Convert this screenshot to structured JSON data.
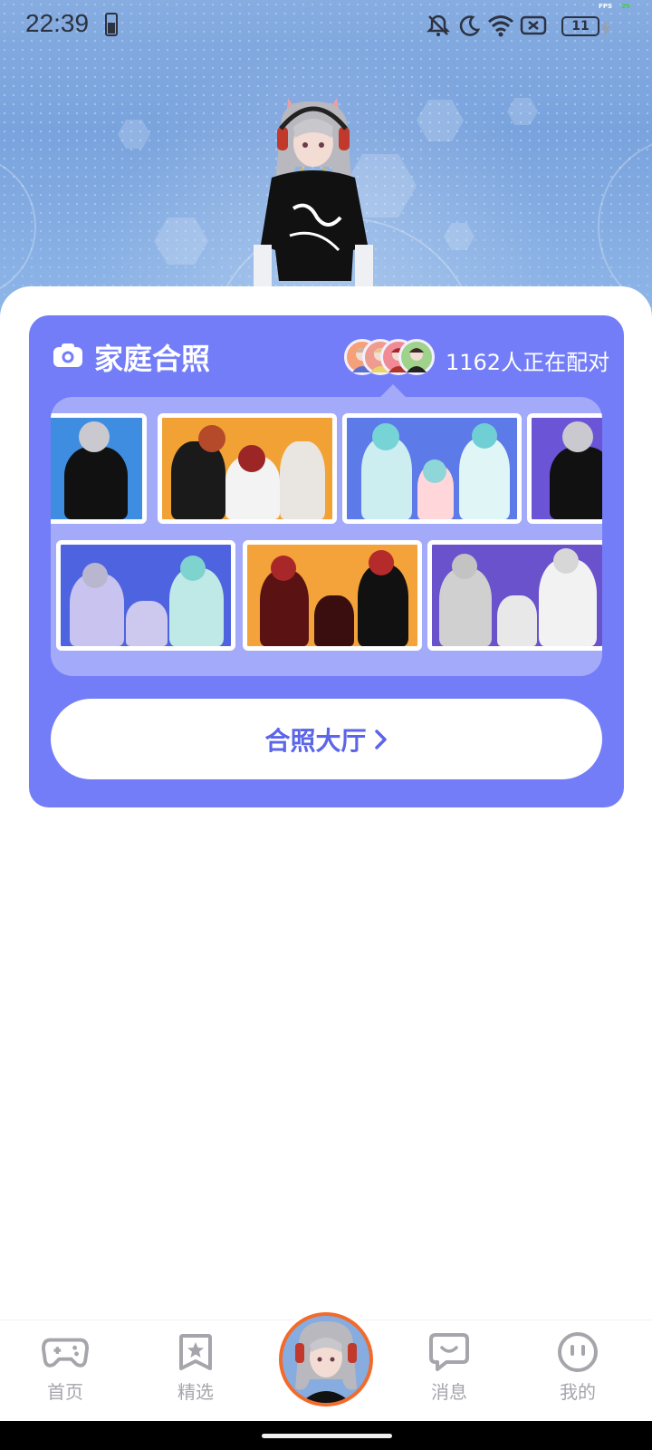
{
  "status_bar": {
    "time": "22:39",
    "battery_level": "11",
    "fps_label": "FPS",
    "fps_value": "29"
  },
  "card": {
    "title": "家庭合照",
    "pairing_text": "1162人正在配对",
    "accent_color": "#737df8"
  },
  "hall_button": {
    "label": "合照大厅"
  },
  "bottom_nav": {
    "items": [
      {
        "label": "首页",
        "icon": "gamepad-icon"
      },
      {
        "label": "精选",
        "icon": "star-bookmark-icon"
      },
      {
        "label": "消息",
        "icon": "chat-smile-icon"
      },
      {
        "label": "我的",
        "icon": "face-icon"
      }
    ],
    "center_avatar_border": "#f36a2a"
  }
}
